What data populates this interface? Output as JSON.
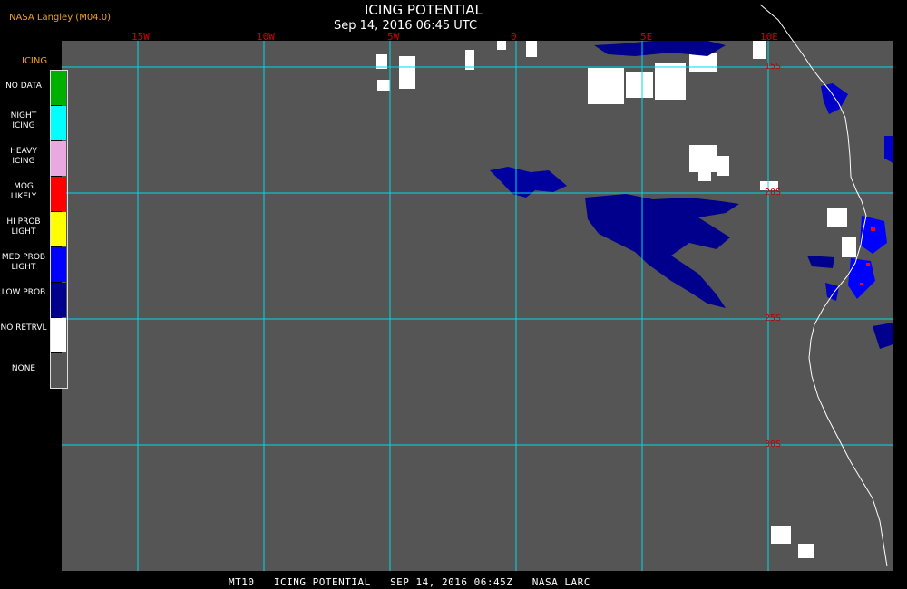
{
  "header": {
    "provider": "NASA Langley (M04.0)",
    "title": "ICING POTENTIAL",
    "subtitle": "Sep 14, 2016 06:45 UTC"
  },
  "longitude_labels": [
    "15W",
    "10W",
    "5W",
    "0",
    "5E",
    "10E"
  ],
  "latitude_labels": [
    "15S",
    "20S",
    "25S",
    "30S"
  ],
  "legend": {
    "title": "ICING",
    "items": [
      {
        "label": "NO DATA",
        "color": "#00b000"
      },
      {
        "label": "NIGHT ICING",
        "color": "#00ffff"
      },
      {
        "label": "HEAVY ICING",
        "color": "#e8a8e0"
      },
      {
        "label": "MOG LIKELY",
        "color": "#ff0000"
      },
      {
        "label": "HI PROB LIGHT",
        "color": "#ffff00"
      },
      {
        "label": "MED PROB LIGHT",
        "color": "#0000ff"
      },
      {
        "label": "LOW PROB",
        "color": "#00008c"
      },
      {
        "label": "NO RETRVL",
        "color": "#ffffff"
      },
      {
        "label": "NONE",
        "color": "#555555"
      }
    ]
  },
  "footer": "MT10   ICING POTENTIAL   SEP 14, 2016 06:45Z   NASA LARC",
  "colors": {
    "background": "#555555",
    "grid": "#00d8e8",
    "coastline": "#ffffff"
  }
}
